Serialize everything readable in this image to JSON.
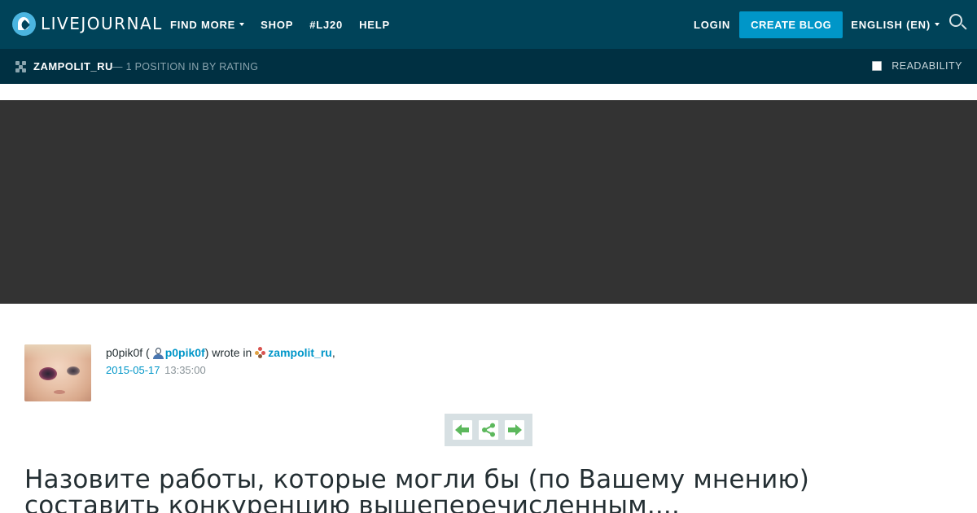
{
  "header": {
    "logo_text": "LIVEJOURNAL",
    "nav": [
      {
        "label": "FIND MORE",
        "dropdown": true
      },
      {
        "label": "SHOP",
        "dropdown": false
      },
      {
        "label": "#LJ20",
        "dropdown": false
      },
      {
        "label": "HELP",
        "dropdown": false
      }
    ],
    "login_label": "LOGIN",
    "create_blog_label": "CREATE BLOG",
    "language_label": "ENGLISH (EN)",
    "search_icon": "search-icon"
  },
  "subheader": {
    "journal_name": "ZAMPOLIT_RU",
    "rating_text": "— 1 POSITION IN BY RATING",
    "readability_label": "READABILITY",
    "readability_checked": false
  },
  "post": {
    "author_display": "p0pik0f (",
    "author_link": "p0pik0f",
    "wrote_in": ") wrote in",
    "community_link": "zampolit_ru",
    "comma": ",",
    "date": "2015-05-17",
    "time": "13:35:00",
    "title": "Назовите работы, которые могли бы (по Вашему мнению) составить конкуренцию вышеперечисленным...."
  },
  "colors": {
    "header_bg": "#004359",
    "subheader_bg": "#003042",
    "accent": "#0096c8",
    "banner_bg": "#333333",
    "nav_arrow": "#5cb85c"
  }
}
